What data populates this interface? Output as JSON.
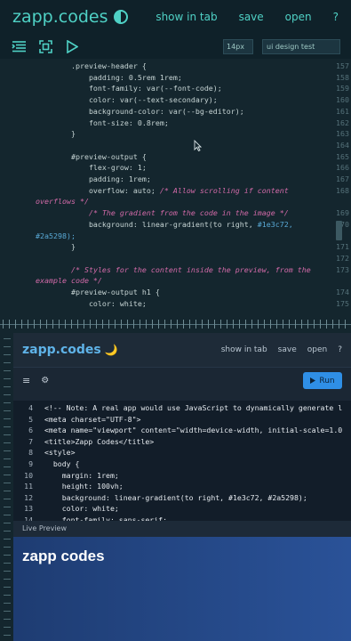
{
  "app": {
    "title": "zapp.codes",
    "nav": [
      "show in tab",
      "save",
      "open",
      "?"
    ],
    "font_size": "14px",
    "title_input": "ui design test"
  },
  "editor": {
    "lines": [
      {
        "n": "157",
        "code": "        .preview-header {"
      },
      {
        "n": "158",
        "code": "            padding: 0.5rem 1rem;"
      },
      {
        "n": "159",
        "code": "            font-family: var(--font-code);"
      },
      {
        "n": "160",
        "code": "            color: var(--text-secondary);"
      },
      {
        "n": "161",
        "code": "            background-color: var(--bg-editor);"
      },
      {
        "n": "162",
        "code": "            font-size: 0.8rem;"
      },
      {
        "n": "163",
        "code": "        }"
      },
      {
        "n": "164",
        "code": ""
      },
      {
        "n": "165",
        "code": "        #preview-output {"
      },
      {
        "n": "166",
        "code": "            flex-grow: 1;"
      },
      {
        "n": "167",
        "code": "            padding: 1rem;"
      },
      {
        "n": "168",
        "code": "            overflow: auto; ",
        "comment": "/* Allow scrolling if content",
        "wrap": "overflows */"
      },
      {
        "n": "169",
        "code": "            ",
        "comment": "/* The gradient from the code in the image */"
      },
      {
        "n": "170",
        "code": "            background: linear-gradient(to right, ",
        "num1": "#1e3c72,",
        "wrap_num": "#2a5298);"
      },
      {
        "n": "171",
        "code": "        }"
      },
      {
        "n": "172",
        "code": ""
      },
      {
        "n": "173",
        "code": "        ",
        "comment": "/* Styles for the content inside the preview, from the",
        "wrap": "example code */"
      },
      {
        "n": "174",
        "code": "        #preview-output h1 {"
      },
      {
        "n": "175",
        "code": "            color: white;"
      }
    ]
  },
  "preview_app": {
    "title": "zapp.codes",
    "moon": "🌙",
    "nav": [
      "show in tab",
      "save",
      "open",
      "?"
    ],
    "menu_icon": "≡",
    "settings_icon": "⚙",
    "run_label": "Run",
    "code_lines": [
      {
        "n": "4",
        "code": "<!-- Note: A real app would use JavaScript to dynamically generate l"
      },
      {
        "n": "5",
        "code": "<meta charset=\"UTF-8\">"
      },
      {
        "n": "6",
        "code": "<meta name=\"viewport\" content=\"width=device-width, initial-scale=1.0"
      },
      {
        "n": "7",
        "code": "<title>Zapp Codes</title>"
      },
      {
        "n": "8",
        "code": "<style>"
      },
      {
        "n": "9",
        "code": "  body {"
      },
      {
        "n": "10",
        "code": "    margin: 1rem;"
      },
      {
        "n": "11",
        "code": "    height: 100vh;"
      },
      {
        "n": "12",
        "code": "    background: linear-gradient(to right, #1e3c72, #2a5298);"
      },
      {
        "n": "13",
        "code": "    color: white;"
      },
      {
        "n": "14",
        "code": "    font-family: sans-serif;"
      }
    ],
    "live_preview_label": "Live Preview",
    "output_heading": "zapp codes"
  },
  "colors": {
    "accent": "#4fd1c5",
    "comment": "#d26aa8",
    "number": "#59a9d6",
    "run_button": "#2f8fe6",
    "gradient_start": "#1e3c72",
    "gradient_end": "#2a5298"
  }
}
